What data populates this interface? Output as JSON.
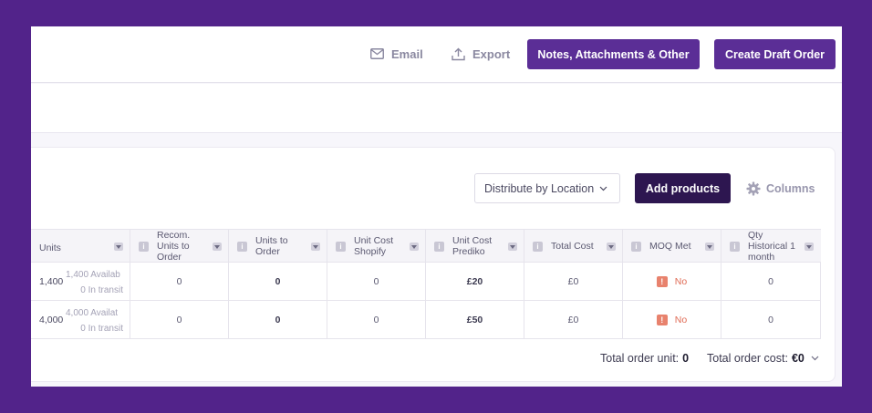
{
  "toolbar": {
    "email_label": "Email",
    "export_label": "Export",
    "notes_label": "Notes, Attachments & Other",
    "create_draft_label": "Create Draft Order"
  },
  "card_actions": {
    "distribute_label": "Distribute by Location",
    "add_products_label": "Add products",
    "columns_label": "Columns"
  },
  "table": {
    "headers": {
      "units": "Units",
      "recom_units": "Recom. Units to Order",
      "units_to_order": "Units to Order",
      "unit_cost_shopify": "Unit Cost Shopify",
      "unit_cost_prediko": "Unit Cost Prediko",
      "total_cost": "Total Cost",
      "moq_met": "MOQ Met",
      "qty_historical": "Qty Historical 1 month"
    },
    "rows": [
      {
        "units": "1,400",
        "available": "1,400 Availab",
        "in_transit": "0 In transit",
        "recom_units": "0",
        "units_to_order": "0",
        "unit_cost_shopify": "0",
        "unit_cost_prediko": "£20",
        "total_cost": "£0",
        "moq_met": "No",
        "qty_historical": "0"
      },
      {
        "units": "4,000",
        "available": "4,000 Availat",
        "in_transit": "0 In transit",
        "recom_units": "0",
        "units_to_order": "0",
        "unit_cost_shopify": "0",
        "unit_cost_prediko": "£50",
        "total_cost": "£0",
        "moq_met": "No",
        "qty_historical": "0"
      }
    ]
  },
  "totals": {
    "order_unit_label": "Total order unit:",
    "order_unit_value": "0",
    "order_cost_label": "Total order cost:",
    "order_cost_value": "€0"
  },
  "colors": {
    "background": "#52238a",
    "primary_button": "#5b2e96",
    "dark_button": "#2d1650",
    "warning": "#e06b55"
  }
}
